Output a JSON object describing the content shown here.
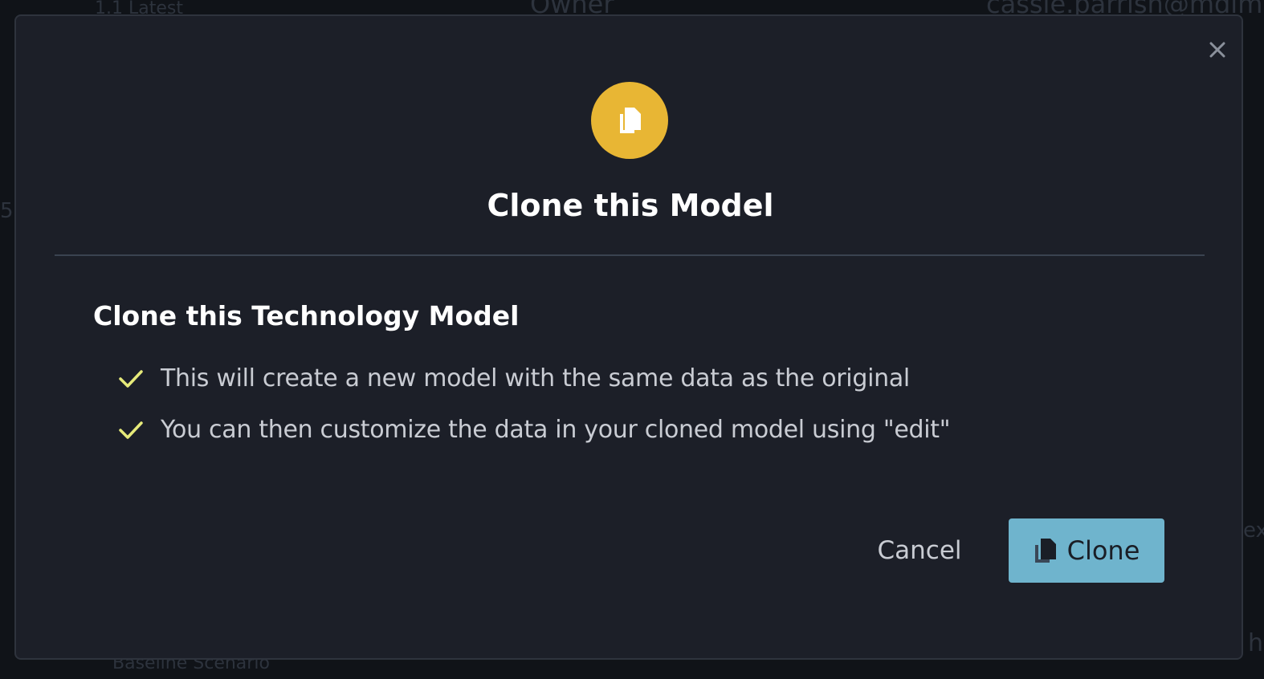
{
  "background": {
    "version_label": "1.1 Latest",
    "caret": "^",
    "owner_label": "Owner",
    "owner_email": "cassie.parrish@mdim",
    "scenario_label": "Baseline Scenario",
    "side_fragment_left": "5",
    "side_fragment_right": "ex",
    "side_fragment_bottom_right": "h"
  },
  "dialog": {
    "title": "Clone this Model",
    "header_icon": "copy-icon",
    "accent_color": "#e8b634",
    "close_icon": "close-icon",
    "section_title": "Clone this Technology Model",
    "check_color": "#e6ea7a",
    "items": [
      {
        "icon": "check-icon",
        "text": "This will create a new model with the same data as the original"
      },
      {
        "icon": "check-icon",
        "text": "You can then customize the data in your cloned model using \"edit\""
      }
    ],
    "cancel_label": "Cancel",
    "clone_label": "Clone",
    "clone_icon": "copy-icon",
    "clone_button_color": "#6fb4cd"
  }
}
